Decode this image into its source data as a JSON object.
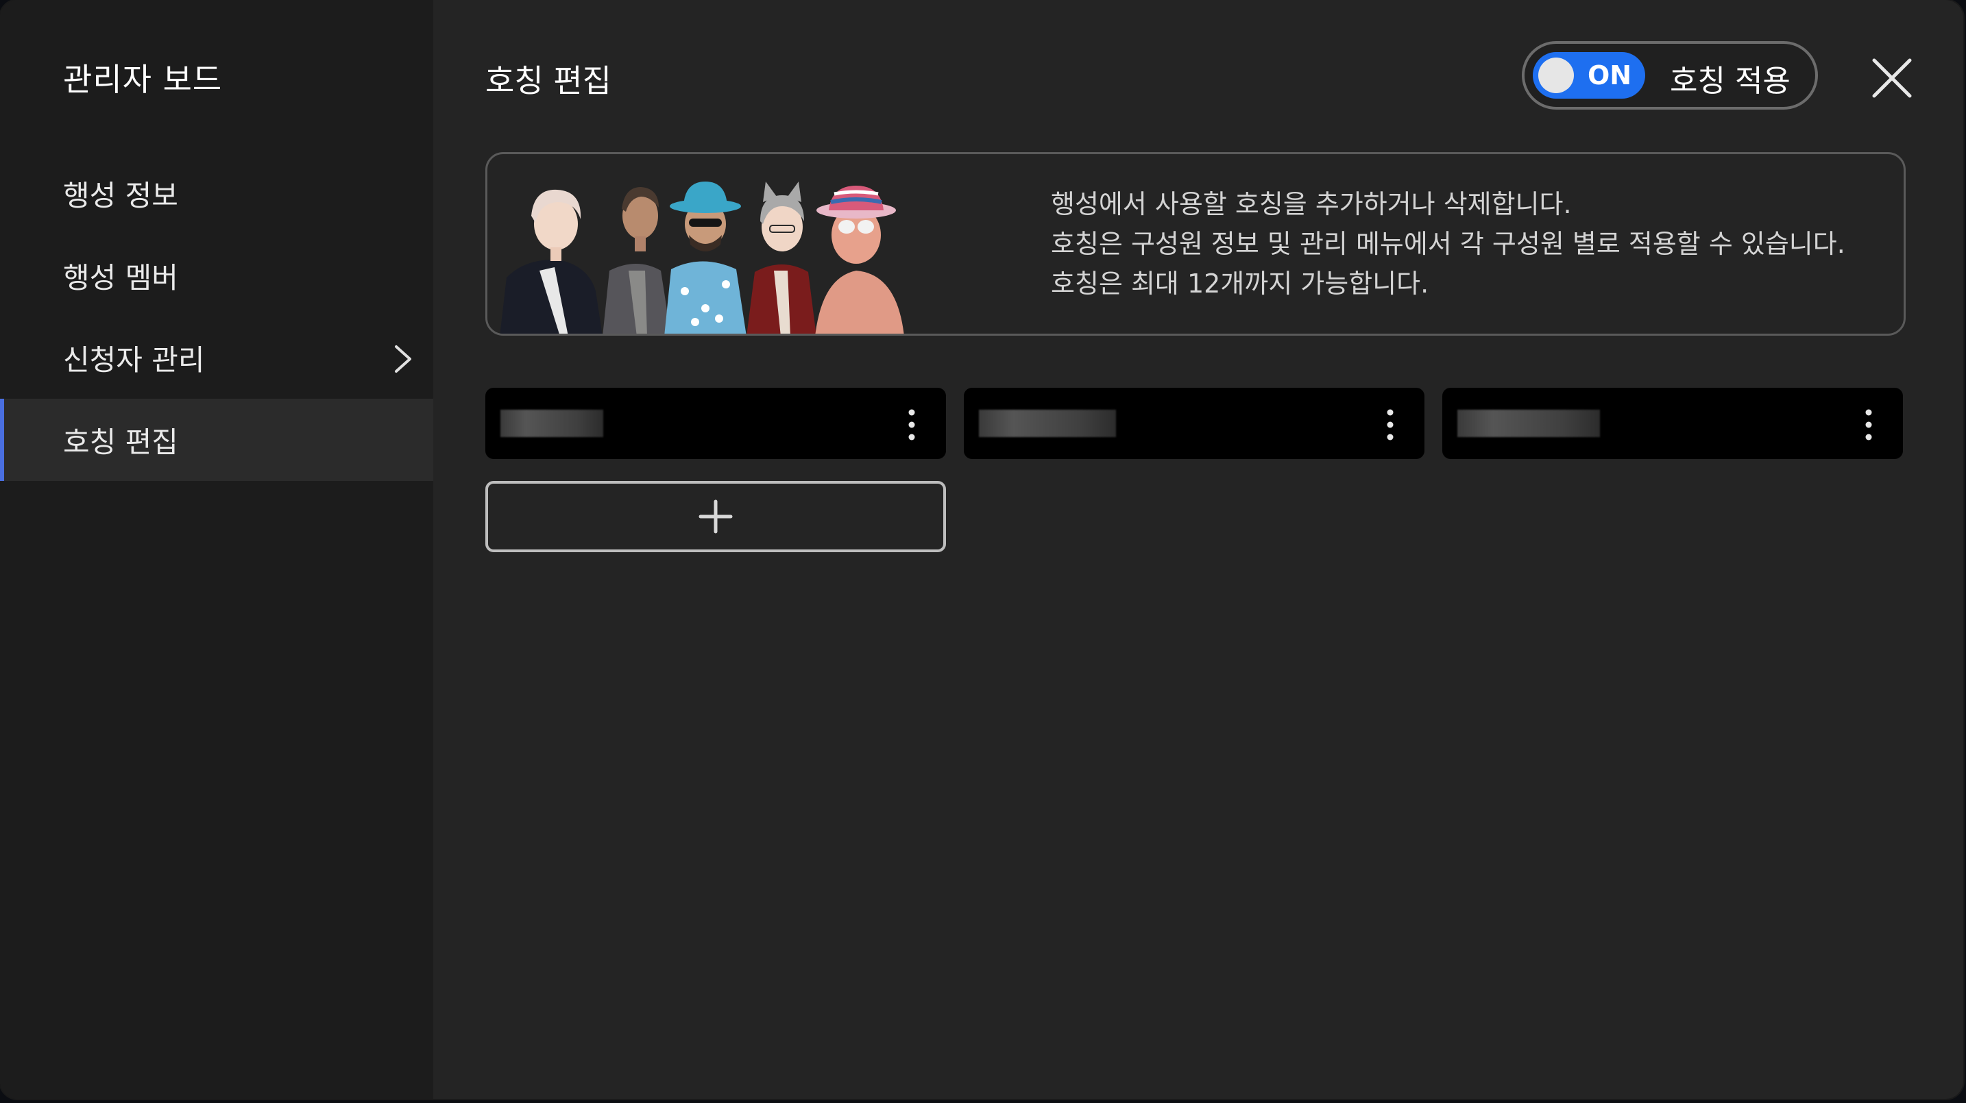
{
  "sidebar": {
    "title": "관리자 보드",
    "items": [
      {
        "label": "행성 정보",
        "active": false,
        "has_submenu": false
      },
      {
        "label": "행성 멤버",
        "active": false,
        "has_submenu": false
      },
      {
        "label": "신청자 관리",
        "active": false,
        "has_submenu": true
      },
      {
        "label": "호칭 편집",
        "active": true,
        "has_submenu": false
      }
    ]
  },
  "header": {
    "title": "호칭 편집",
    "toggle": {
      "state_label": "ON",
      "label": "호칭 적용",
      "on": true
    },
    "close_icon": "close-icon"
  },
  "info": {
    "lines": [
      "행성에서 사용할 호칭을 추가하거나 삭제합니다.",
      "호칭은 구성원 정보 및 관리 메뉴에서 각 구성원 별로 적용할 수 있습니다.",
      "호칭은 최대 12개까지 가능합니다."
    ]
  },
  "titles": {
    "items": [
      {
        "redacted": true
      },
      {
        "redacted": true
      },
      {
        "redacted": true
      }
    ],
    "add_icon": "plus-icon"
  },
  "colors": {
    "accent": "#1e6ff0",
    "background": "#242424",
    "sidebar": "#1c1c1c",
    "active_indicator": "#4a6fe0"
  }
}
